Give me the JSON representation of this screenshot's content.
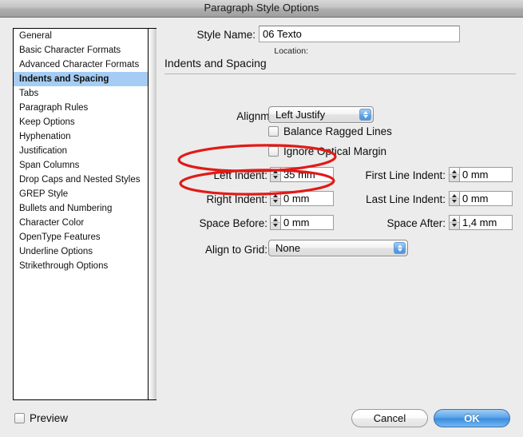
{
  "window": {
    "title": "Paragraph Style Options"
  },
  "sidebar": {
    "items": [
      {
        "label": "General",
        "selected": false
      },
      {
        "label": "Basic Character Formats",
        "selected": false
      },
      {
        "label": "Advanced Character Formats",
        "selected": false
      },
      {
        "label": "Indents and Spacing",
        "selected": true
      },
      {
        "label": "Tabs",
        "selected": false
      },
      {
        "label": "Paragraph Rules",
        "selected": false
      },
      {
        "label": "Keep Options",
        "selected": false
      },
      {
        "label": "Hyphenation",
        "selected": false
      },
      {
        "label": "Justification",
        "selected": false
      },
      {
        "label": "Span Columns",
        "selected": false
      },
      {
        "label": "Drop Caps and Nested Styles",
        "selected": false
      },
      {
        "label": "GREP Style",
        "selected": false
      },
      {
        "label": "Bullets and Numbering",
        "selected": false
      },
      {
        "label": "Character Color",
        "selected": false
      },
      {
        "label": "OpenType Features",
        "selected": false
      },
      {
        "label": "Underline Options",
        "selected": false
      },
      {
        "label": "Strikethrough Options",
        "selected": false
      }
    ]
  },
  "form": {
    "style_name_label": "Style Name:",
    "style_name_value": "06 Texto",
    "location_label": "Location:",
    "section_title": "Indents and Spacing",
    "alignment_label": "Alignment:",
    "alignment_value": "Left Justify",
    "balance_ragged_lines_label": "Balance Ragged Lines",
    "ignore_optical_margin_label": "Ignore Optical Margin",
    "left_indent_label": "Left Indent:",
    "left_indent_value": "35 mm",
    "first_line_indent_label": "First Line Indent:",
    "first_line_indent_value": "0 mm",
    "right_indent_label": "Right Indent:",
    "right_indent_value": "0 mm",
    "last_line_indent_label": "Last Line Indent:",
    "last_line_indent_value": "0 mm",
    "space_before_label": "Space Before:",
    "space_before_value": "0 mm",
    "space_after_label": "Space After:",
    "space_after_value": "1,4 mm",
    "align_to_grid_label": "Align to Grid:",
    "align_to_grid_value": "None"
  },
  "footer": {
    "preview_label": "Preview",
    "cancel_label": "Cancel",
    "ok_label": "OK"
  },
  "annotations": {
    "highlight_color": "#e01b18",
    "marked_fields": [
      "Left Indent:",
      "Right Indent:"
    ]
  }
}
